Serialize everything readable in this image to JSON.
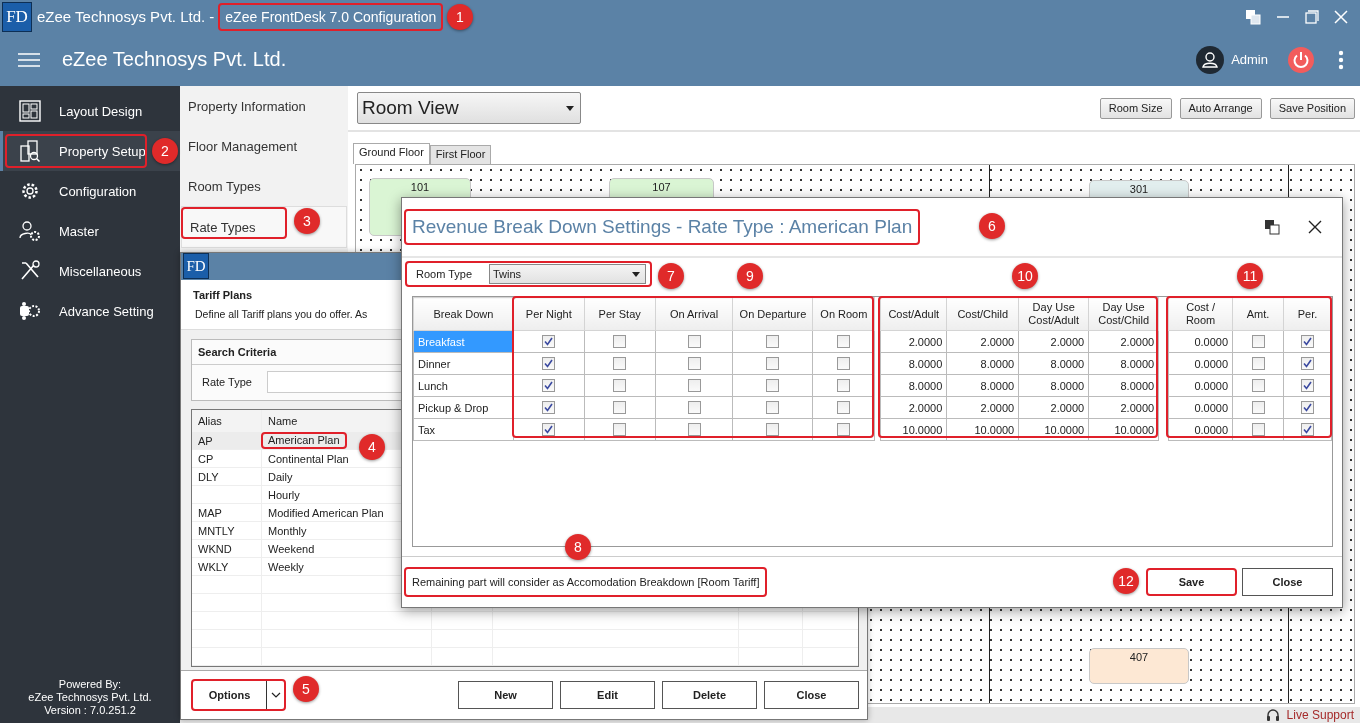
{
  "window": {
    "logo": "FD",
    "company": "eZee Technosys Pvt. Ltd. -",
    "title": "eZee FrontDesk 7.0 Configuration"
  },
  "header": {
    "company": "eZee Technosys Pvt. Ltd.",
    "user": "Admin"
  },
  "sidebar": {
    "items": [
      {
        "label": "Layout Design",
        "kind": "layout",
        "selected": false
      },
      {
        "label": "Property Setup",
        "kind": "building",
        "selected": true
      },
      {
        "label": "Configuration",
        "kind": "gear",
        "selected": false
      },
      {
        "label": "Master",
        "kind": "usergear",
        "selected": false
      },
      {
        "label": "Miscellaneous",
        "kind": "tools",
        "selected": false
      },
      {
        "label": "Advance Setting",
        "kind": "advance",
        "selected": false
      }
    ],
    "footer": [
      "Powered By:",
      "eZee Technosys Pvt. Ltd.",
      "Version : 7.0.251.2"
    ]
  },
  "submenu": {
    "items": [
      {
        "label": "Property Information",
        "selected": false
      },
      {
        "label": "Floor Management",
        "selected": false
      },
      {
        "label": "Room Types",
        "selected": false
      },
      {
        "label": "Rate Types",
        "selected": true
      }
    ]
  },
  "room_view": {
    "view": "Room View",
    "buttons": [
      "Room Size",
      "Auto Arrange",
      "Save Position"
    ],
    "tabs": [
      {
        "label": "Ground Floor",
        "selected": true
      },
      {
        "label": "First Floor",
        "selected": false
      }
    ],
    "rooms": [
      {
        "number": "101",
        "color": "#daf5d4"
      },
      {
        "number": "107",
        "color": "#daf5d4"
      },
      {
        "number": "301",
        "color": "#e2eeee"
      },
      {
        "number": "407",
        "color": "#fde8d4"
      }
    ]
  },
  "tariff_window": {
    "logo": "FD",
    "title": "Tariff Plans",
    "description": "Define all Tariff plans you do offer. As",
    "search": {
      "title": "Search Criteria",
      "label": "Rate Type"
    },
    "columns": [
      "Alias",
      "Name"
    ],
    "rows": [
      {
        "alias": "AP",
        "name": "American Plan",
        "selected": true
      },
      {
        "alias": "CP",
        "name": "Continental Plan",
        "selected": false
      },
      {
        "alias": "DLY",
        "name": "Daily",
        "selected": false
      },
      {
        "alias": "",
        "name": "Hourly",
        "selected": false
      },
      {
        "alias": "MAP",
        "name": "Modified American Plan",
        "selected": false
      },
      {
        "alias": "MNTLY",
        "name": "Monthly",
        "selected": false
      },
      {
        "alias": "WKND",
        "name": "Weekend",
        "selected": false
      },
      {
        "alias": "WKLY",
        "name": "Weekly",
        "selected": false
      }
    ],
    "options": "Options",
    "buttons": [
      "New",
      "Edit",
      "Delete",
      "Close"
    ]
  },
  "dialog": {
    "title": "Revenue Break Down Settings - Rate Type : American Plan",
    "room_type_label": "Room Type",
    "room_type": "Twins",
    "columns": [
      "Break Down",
      "Per Night",
      "Per Stay",
      "On Arrival",
      "On Departure",
      "On Room",
      "Cost/Adult",
      "Cost/Child",
      "Day Use Cost/Adult",
      "Day Use Cost/Child",
      "Cost / Room",
      "Amt.",
      "Per."
    ],
    "rows": [
      {
        "name": "Breakfast",
        "selected": true,
        "per_night": true,
        "per_stay": false,
        "on_arrival": false,
        "on_departure": false,
        "on_room": false,
        "costs": [
          "2.0000",
          "2.0000",
          "2.0000",
          "2.0000"
        ],
        "cost_room": "0.0000",
        "amount": false,
        "percent": true
      },
      {
        "name": "Dinner",
        "selected": false,
        "per_night": true,
        "per_stay": false,
        "on_arrival": false,
        "on_departure": false,
        "on_room": false,
        "costs": [
          "8.0000",
          "8.0000",
          "8.0000",
          "8.0000"
        ],
        "cost_room": "0.0000",
        "amount": false,
        "percent": true
      },
      {
        "name": "Lunch",
        "selected": false,
        "per_night": true,
        "per_stay": false,
        "on_arrival": false,
        "on_departure": false,
        "on_room": false,
        "costs": [
          "8.0000",
          "8.0000",
          "8.0000",
          "8.0000"
        ],
        "cost_room": "0.0000",
        "amount": false,
        "percent": true
      },
      {
        "name": "Pickup & Drop",
        "selected": false,
        "per_night": true,
        "per_stay": false,
        "on_arrival": false,
        "on_departure": false,
        "on_room": false,
        "costs": [
          "2.0000",
          "2.0000",
          "2.0000",
          "2.0000"
        ],
        "cost_room": "0.0000",
        "amount": false,
        "percent": true
      },
      {
        "name": "Tax",
        "selected": false,
        "per_night": true,
        "per_stay": false,
        "on_arrival": false,
        "on_departure": false,
        "on_room": false,
        "costs": [
          "10.0000",
          "10.0000",
          "10.0000",
          "10.0000"
        ],
        "cost_room": "0.0000",
        "amount": false,
        "percent": true
      }
    ],
    "note": "Remaining part will consider as Accomodation Breakdown [Room Tariff]",
    "buttons": [
      "Save",
      "Close"
    ]
  },
  "status_bar": {
    "live_support": "Live Support"
  },
  "callouts": [
    {
      "label": "1"
    },
    {
      "label": "2"
    },
    {
      "label": "3"
    },
    {
      "label": "4"
    },
    {
      "label": "5"
    },
    {
      "label": "6"
    },
    {
      "label": "7"
    },
    {
      "label": "8"
    },
    {
      "label": "9"
    },
    {
      "label": "10"
    },
    {
      "label": "11"
    },
    {
      "label": "12"
    }
  ]
}
